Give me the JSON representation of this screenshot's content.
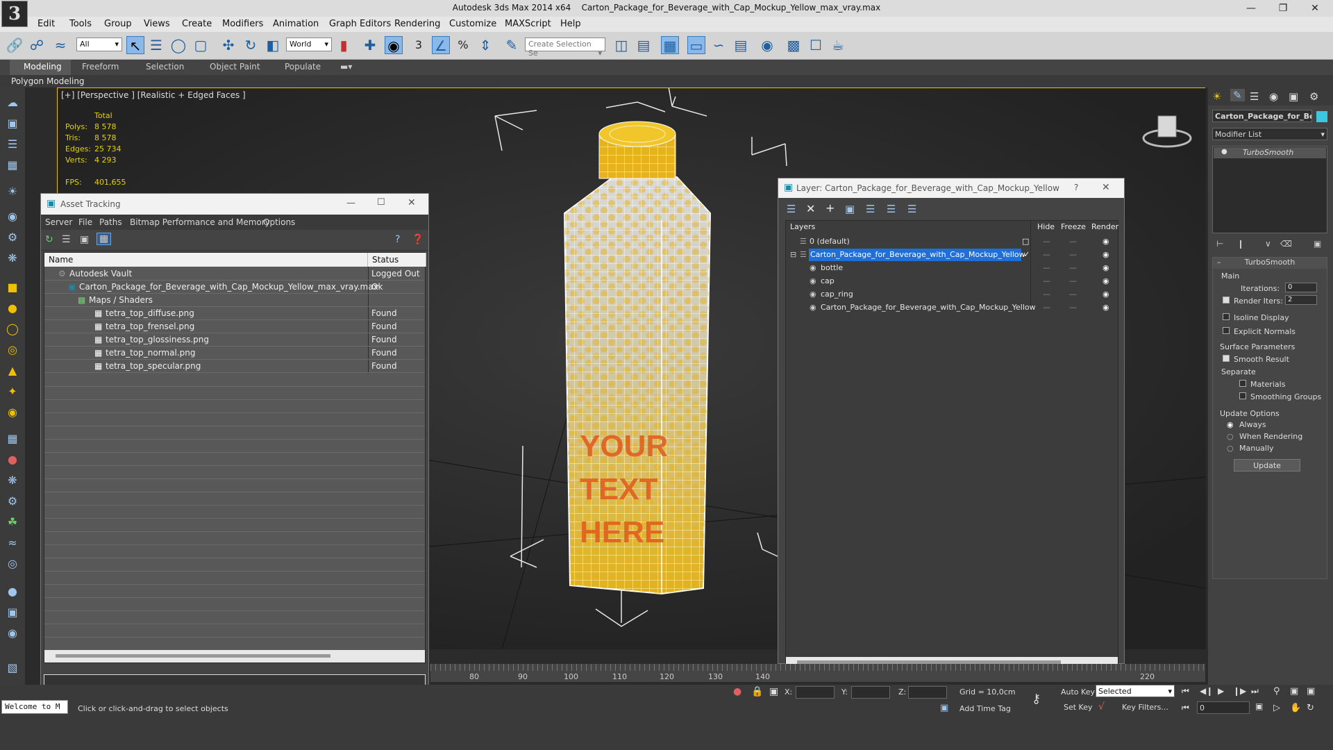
{
  "window": {
    "app_title": "Autodesk 3ds Max  2014 x64",
    "file_title": "Carton_Package_for_Beverage_with_Cap_Mockup_Yellow_max_vray.max",
    "logo": "3"
  },
  "menu": [
    "Edit",
    "Tools",
    "Group",
    "Views",
    "Create",
    "Modifiers",
    "Animation",
    "Graph Editors",
    "Rendering",
    "Customize",
    "MAXScript",
    "Help"
  ],
  "toolbar": {
    "filter_value": "All",
    "coord_value": "World",
    "snap_label": "3",
    "selection_set_placeholder": "Create Selection Se"
  },
  "ribbon": {
    "tabs": [
      "Modeling",
      "Freeform",
      "Selection",
      "Object Paint",
      "Populate"
    ],
    "subtitle": "Polygon Modeling"
  },
  "viewport": {
    "label": "[+] [Perspective ] [Realistic + Edged Faces ]",
    "stats_header": "Total",
    "stats": [
      {
        "label": "Polys:",
        "value": "8 578"
      },
      {
        "label": "Tris:",
        "value": "8 578"
      },
      {
        "label": "Edges:",
        "value": "25 734"
      },
      {
        "label": "Verts:",
        "value": "4 293"
      }
    ],
    "fps_label": "FPS:",
    "fps_value": "401,655",
    "product_text": "YOUR TEXT HERE",
    "accent_color": "#e6b31c",
    "viewport_border_color": "#f0c000"
  },
  "asset_tracking": {
    "title": "Asset Tracking",
    "menu": [
      "Server",
      "File",
      "Paths",
      "Bitmap Performance and Memory",
      "Options"
    ],
    "columns": {
      "name": "Name",
      "status": "Status"
    },
    "rows": [
      {
        "name": "Autodesk Vault",
        "status": "Logged Out ...",
        "indent": 0
      },
      {
        "name": "Carton_Package_for_Beverage_with_Cap_Mockup_Yellow_max_vray.max",
        "status": "Ok",
        "indent": 1
      },
      {
        "name": "Maps / Shaders",
        "status": "",
        "indent": 2
      },
      {
        "name": "tetra_top_diffuse.png",
        "status": "Found",
        "indent": 3
      },
      {
        "name": "tetra_top_frensel.png",
        "status": "Found",
        "indent": 3
      },
      {
        "name": "tetra_top_glossiness.png",
        "status": "Found",
        "indent": 3
      },
      {
        "name": "tetra_top_normal.png",
        "status": "Found",
        "indent": 3
      },
      {
        "name": "tetra_top_specular.png",
        "status": "Found",
        "indent": 3
      }
    ]
  },
  "layer_window": {
    "title": "Layer: Carton_Package_for_Beverage_with_Cap_Mockup_Yellow",
    "help": "?",
    "columns": {
      "layers": "Layers",
      "hide": "Hide",
      "freeze": "Freeze",
      "render": "Render"
    },
    "rows": [
      {
        "name": "0 (default)",
        "indent": 0,
        "selected": false
      },
      {
        "name": "Carton_Package_for_Beverage_with_Cap_Mockup_Yellow",
        "indent": 0,
        "selected": true
      },
      {
        "name": "bottle",
        "indent": 1,
        "selected": false
      },
      {
        "name": "cap",
        "indent": 1,
        "selected": false
      },
      {
        "name": "cap_ring",
        "indent": 1,
        "selected": false
      },
      {
        "name": "Carton_Package_for_Beverage_with_Cap_Mockup_Yellow",
        "indent": 1,
        "selected": false
      }
    ],
    "selected_color": "#1e6fd9"
  },
  "command_panel": {
    "object_name": "Carton_Package_for_Bev",
    "modifier_list_label": "Modifier List",
    "stack_item": "TurboSmooth",
    "rollout_title": "TurboSmooth",
    "main_label": "Main",
    "iterations_label": "Iterations:",
    "iterations_value": "0",
    "render_iters_label": "Render Iters:",
    "render_iters_value": "2",
    "isoline_label": "Isoline Display",
    "explicit_label": "Explicit Normals",
    "surface_label": "Surface Parameters",
    "smooth_label": "Smooth Result",
    "separate_label": "Separate",
    "materials_label": "Materials",
    "smoothing_groups_label": "Smoothing Groups",
    "update_options_label": "Update Options",
    "always_label": "Always",
    "when_rendering_label": "When Rendering",
    "manually_label": "Manually",
    "update_button": "Update",
    "swatch_color": "#3ec6e0"
  },
  "timeline": {
    "ticks": [
      "80",
      "90",
      "100",
      "110",
      "120",
      "130",
      "140",
      "220"
    ]
  },
  "status": {
    "welcome": "Welcome to M",
    "prompt": "Click or click-and-drag to select objects",
    "x_label": "X:",
    "y_label": "Y:",
    "z_label": "Z:",
    "grid": "Grid = 10,0cm",
    "add_time_tag": "Add Time Tag",
    "auto_key": "Auto Key",
    "set_key": "Set Key",
    "selected_value": "Selected",
    "key_filters": "Key Filters...",
    "frame_value": "0"
  }
}
